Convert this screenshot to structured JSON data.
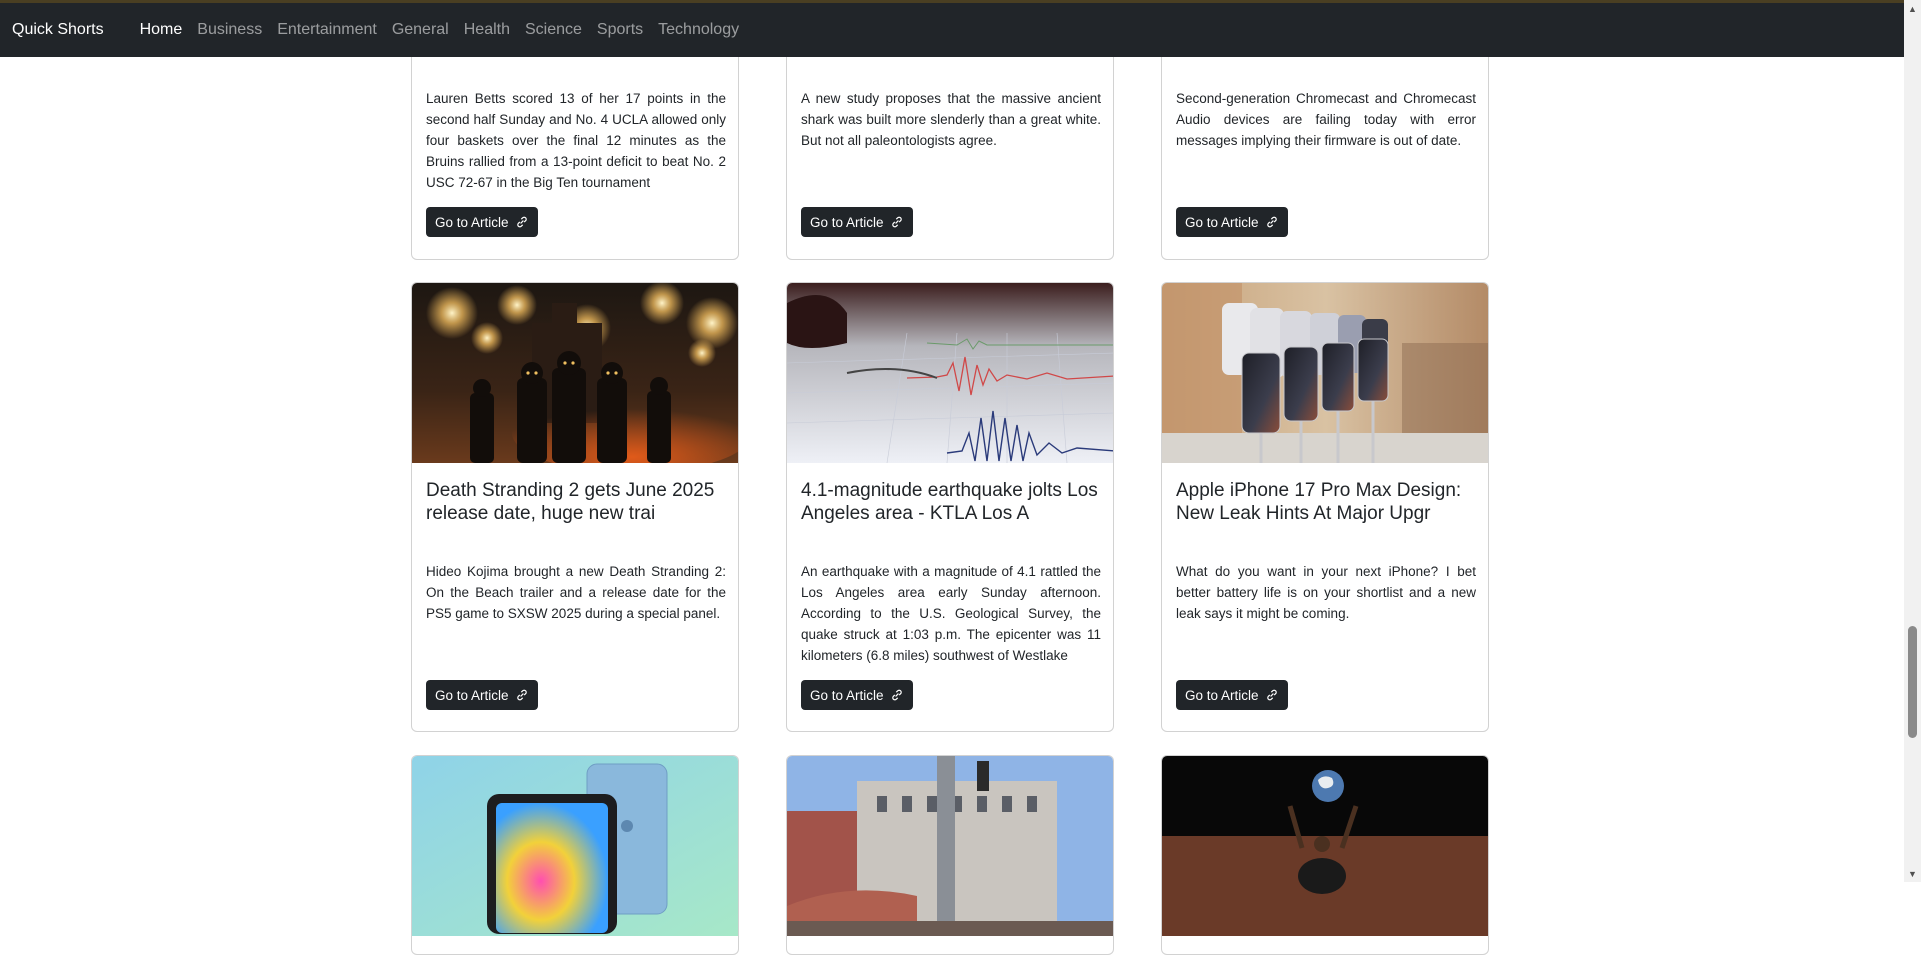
{
  "nav": {
    "brand": "Quick Shorts",
    "links": [
      "Home",
      "Business",
      "Entertainment",
      "General",
      "Health",
      "Science",
      "Sports",
      "Technology"
    ],
    "active": "Home"
  },
  "button_label": "Go to Article",
  "icons": {
    "button": "link-icon",
    "scroll_up": "triangle-up-icon",
    "scroll_down": "triangle-down-icon"
  },
  "colors": {
    "navbar": "#212529",
    "button": "#212529",
    "accent_line": "#4a3f22"
  },
  "row1": [
    {
      "text": "Lauren Betts scored 13 of her 17 points in the second half Sunday and No. 4 UCLA allowed only four baskets over the final 12 minutes as the Bruins rallied from a 13-point deficit to beat No. 2 USC 72-67 in the Big Ten tournament"
    },
    {
      "text": "A new study proposes that the massive ancient shark was built more slenderly than a great white. But not all paleontologists agree."
    },
    {
      "text": "Second-generation Chromecast and Chromecast Audio devices are failing today with error messages implying their firmware is out of date."
    }
  ],
  "row2": [
    {
      "title": "Death Stranding 2 gets June 2025 release date, huge new trai",
      "text": "Hideo Kojima brought a new Death Stranding 2: On the Beach trailer and a release date for the PS5 game to SXSW 2025 during a special panel.",
      "image": "fireworks-soldiers-image"
    },
    {
      "title": "4.1-magnitude earthquake jolts Los Angeles area - KTLA Los A",
      "text": "An earthquake with a magnitude of 4.1 rattled the Los Angeles area early Sunday afternoon. According to the U.S. Geological Survey, the quake struck at 1:03 p.m. The epicenter was 11 kilometers (6.8 miles) southwest of Westlake",
      "image": "seismograph-image"
    },
    {
      "title": "Apple iPhone 17 Pro Max Design: New Leak Hints At Major Upgr",
      "text": "What do you want in your next iPhone? I bet better battery life is on your shortlist and a new leak says it might be coming.",
      "image": "iphones-display-image"
    }
  ],
  "row3": [
    {
      "image": "ipad-image"
    },
    {
      "image": "government-building-image"
    },
    {
      "image": "moon-earth-person-image"
    }
  ]
}
